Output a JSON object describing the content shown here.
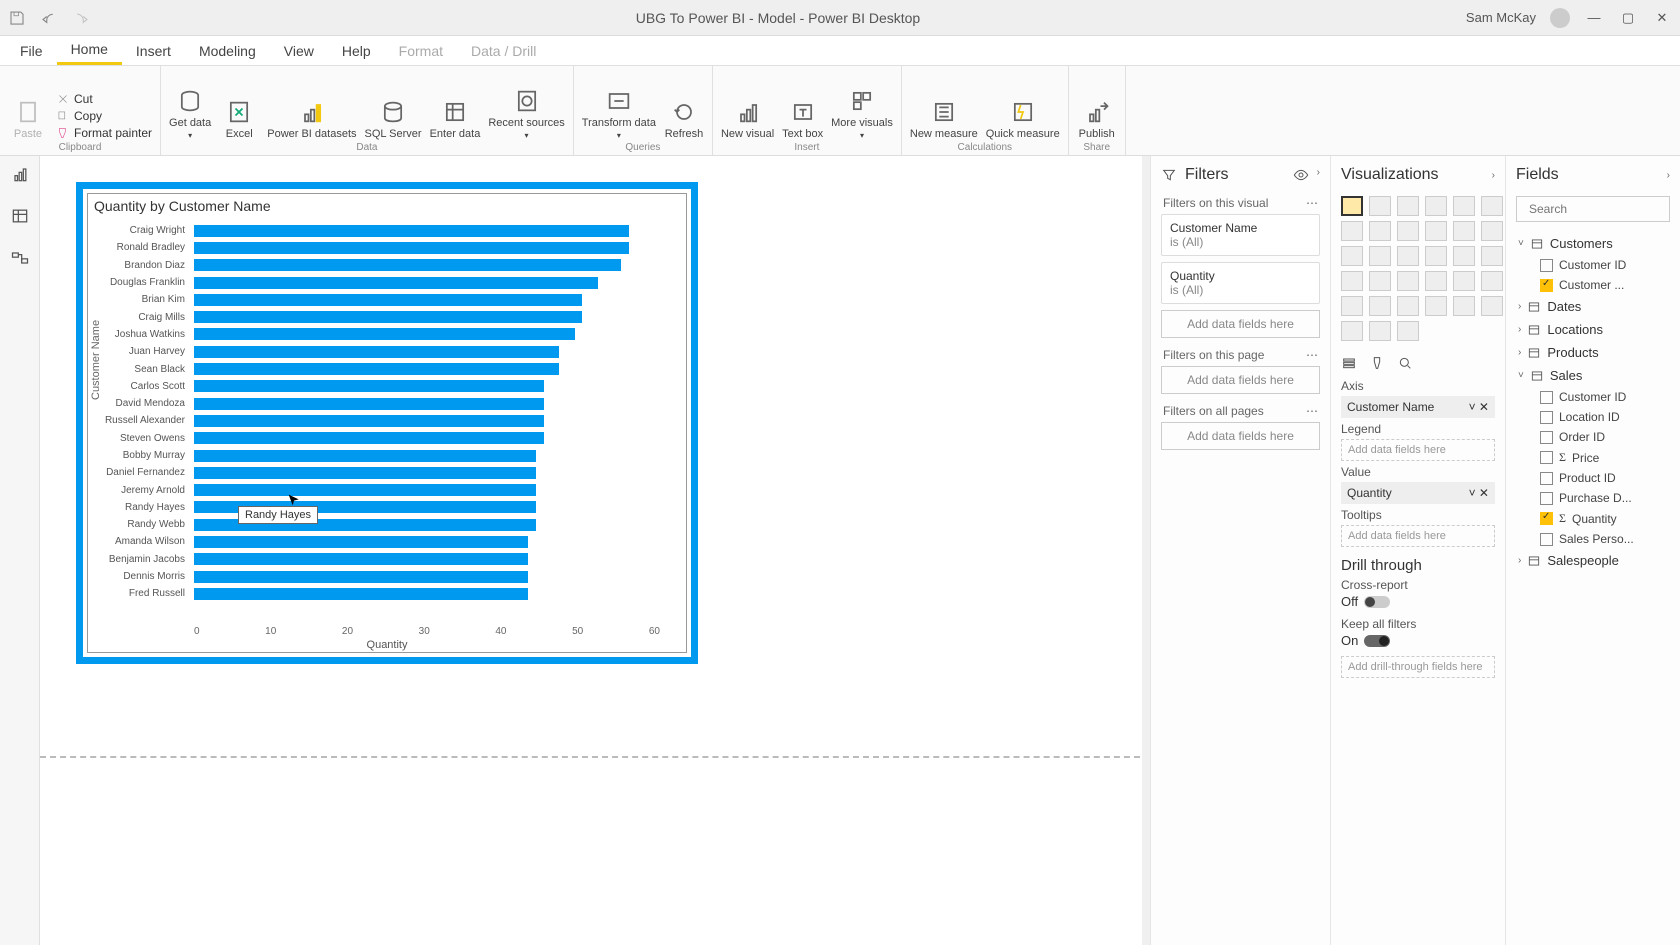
{
  "titlebar": {
    "title": "UBG To Power BI - Model - Power BI Desktop",
    "user": "Sam McKay"
  },
  "menus": [
    "File",
    "Home",
    "Insert",
    "Modeling",
    "View",
    "Help",
    "Format",
    "Data / Drill"
  ],
  "ribbon": {
    "clipboard": {
      "group": "Clipboard",
      "paste": "Paste",
      "cut": "Cut",
      "copy": "Copy",
      "painter": "Format painter"
    },
    "data": {
      "group": "Data",
      "get": "Get data",
      "excel": "Excel",
      "pbids": "Power BI datasets",
      "sql": "SQL Server",
      "enter": "Enter data",
      "recent": "Recent sources"
    },
    "queries": {
      "group": "Queries",
      "transform": "Transform data",
      "refresh": "Refresh"
    },
    "insert": {
      "group": "Insert",
      "newvis": "New visual",
      "text": "Text box",
      "more": "More visuals"
    },
    "calc": {
      "group": "Calculations",
      "newm": "New measure",
      "quickm": "Quick measure"
    },
    "share": {
      "group": "Share",
      "publish": "Publish"
    }
  },
  "chart_data": {
    "type": "bar",
    "title": "Quantity by Customer Name",
    "orientation": "horizontal",
    "xlabel": "Quantity",
    "ylabel": "Customer Name",
    "xlim": [
      0,
      60
    ],
    "xticks": [
      0,
      10,
      20,
      30,
      40,
      50,
      60
    ],
    "tooltip": "Randy Hayes",
    "series": [
      {
        "name": "Quantity",
        "categories": [
          "Craig Wright",
          "Ronald Bradley",
          "Brandon Diaz",
          "Douglas Franklin",
          "Brian Kim",
          "Craig Mills",
          "Joshua Watkins",
          "Juan Harvey",
          "Sean Black",
          "Carlos Scott",
          "David Mendoza",
          "Russell Alexander",
          "Steven Owens",
          "Bobby Murray",
          "Daniel Fernandez",
          "Jeremy Arnold",
          "Randy Hayes",
          "Randy Webb",
          "Amanda Wilson",
          "Benjamin Jacobs",
          "Dennis Morris",
          "Fred Russell"
        ],
        "values": [
          56,
          56,
          55,
          52,
          50,
          50,
          49,
          47,
          47,
          45,
          45,
          45,
          45,
          44,
          44,
          44,
          44,
          44,
          43,
          43,
          43,
          43
        ]
      }
    ]
  },
  "filters": {
    "title": "Filters",
    "visual_label": "Filters on this visual",
    "page_label": "Filters on this page",
    "all_label": "Filters on all pages",
    "add": "Add data fields here",
    "f1_name": "Customer Name",
    "f1_val": "is (All)",
    "f2_name": "Quantity",
    "f2_val": "is (All)"
  },
  "viz": {
    "title": "Visualizations",
    "axis": "Axis",
    "axis_field": "Customer Name",
    "legend": "Legend",
    "legend_drop": "Add data fields here",
    "value": "Value",
    "value_field": "Quantity",
    "tooltips": "Tooltips",
    "tooltips_drop": "Add data fields here",
    "drill": "Drill through",
    "cross": "Cross-report",
    "off": "Off",
    "keep": "Keep all filters",
    "on": "On",
    "drill_drop": "Add drill-through fields here"
  },
  "fields": {
    "title": "Fields",
    "search": "Search",
    "tables": [
      {
        "name": "Customers",
        "open": true,
        "fields": [
          {
            "n": "Customer ID"
          },
          {
            "n": "Customer ...",
            "ck": true
          }
        ]
      },
      {
        "name": "Dates",
        "open": false
      },
      {
        "name": "Locations",
        "open": false
      },
      {
        "name": "Products",
        "open": false
      },
      {
        "name": "Sales",
        "open": true,
        "fields": [
          {
            "n": "Customer ID"
          },
          {
            "n": "Location ID"
          },
          {
            "n": "Order ID"
          },
          {
            "n": "Price",
            "sigma": true
          },
          {
            "n": "Product ID"
          },
          {
            "n": "Purchase D..."
          },
          {
            "n": "Quantity",
            "sigma": true,
            "ck": true
          },
          {
            "n": "Sales Perso..."
          }
        ]
      },
      {
        "name": "Salespeople",
        "open": false
      }
    ]
  }
}
